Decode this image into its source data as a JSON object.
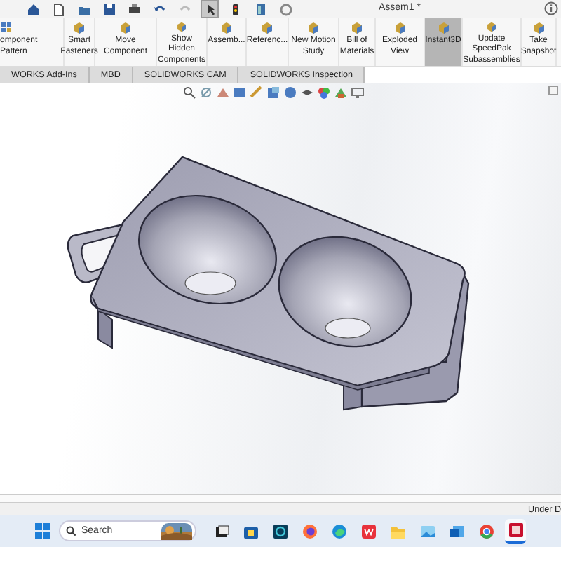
{
  "window": {
    "title": "Assem1 *"
  },
  "quick_access": [
    {
      "kind": "home",
      "selected": false
    },
    {
      "kind": "new",
      "selected": false
    },
    {
      "kind": "open",
      "selected": false
    },
    {
      "kind": "save",
      "selected": false
    },
    {
      "kind": "print",
      "selected": false
    },
    {
      "kind": "undo",
      "selected": false
    },
    {
      "kind": "redo",
      "selected": false
    },
    {
      "kind": "select",
      "selected": true
    },
    {
      "kind": "light",
      "selected": false
    },
    {
      "kind": "file",
      "selected": false
    },
    {
      "kind": "gear",
      "selected": false
    }
  ],
  "ribbon": [
    {
      "label": "omponent Pattern",
      "selected": false
    },
    {
      "label": "Smart Fasteners",
      "selected": false
    },
    {
      "label": "Move Component",
      "selected": false
    },
    {
      "label": "Show Hidden Components",
      "selected": false
    },
    {
      "label": "Assemb...",
      "selected": false
    },
    {
      "label": "Referenc...",
      "selected": false
    },
    {
      "label": "New Motion Study",
      "selected": false
    },
    {
      "label": "Bill of Materials",
      "selected": false
    },
    {
      "label": "Exploded View",
      "selected": false
    },
    {
      "label": "Instant3D",
      "selected": true
    },
    {
      "label": "Update SpeedPak Subassemblies",
      "selected": false
    },
    {
      "label": "Take Snapshot",
      "selected": false
    }
  ],
  "tabs": [
    {
      "label": "WORKS Add-Ins",
      "selected": false
    },
    {
      "label": "MBD",
      "selected": false
    },
    {
      "label": "SOLIDWORKS CAM",
      "selected": false
    },
    {
      "label": "SOLIDWORKS Inspection",
      "selected": false
    }
  ],
  "status_bar": {
    "text": "Under D"
  },
  "taskbar": {
    "search": {
      "placeholder": "Search"
    },
    "apps": [
      {
        "kind": "taskview",
        "selected": false
      },
      {
        "kind": "store",
        "selected": false
      },
      {
        "kind": "teal",
        "selected": false
      },
      {
        "kind": "firefox",
        "selected": false
      },
      {
        "kind": "edge",
        "selected": false
      },
      {
        "kind": "wps",
        "selected": false
      },
      {
        "kind": "folder",
        "selected": false
      },
      {
        "kind": "photos",
        "selected": false
      },
      {
        "kind": "outlook",
        "selected": false
      },
      {
        "kind": "chrome",
        "selected": false
      },
      {
        "kind": "solidworks",
        "selected": true
      }
    ]
  }
}
